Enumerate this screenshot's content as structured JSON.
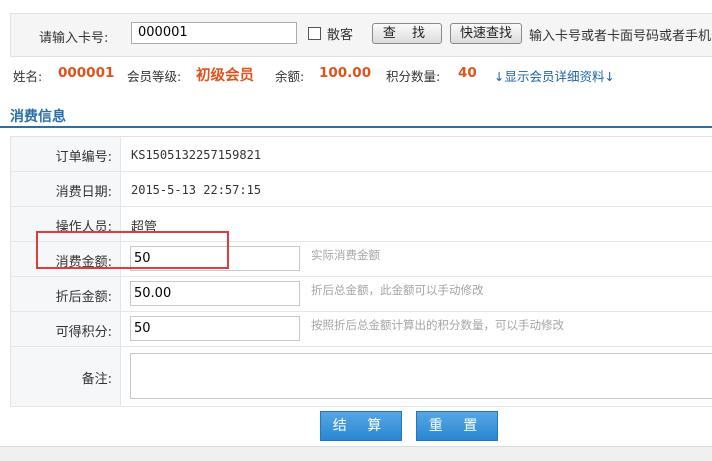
{
  "search": {
    "card_label": "请输入卡号:",
    "card_value": "000001",
    "walkin_label": "散客",
    "walkin_checked": false,
    "find_button": "查 找",
    "quick_find_button": "快速查找",
    "hint": "输入卡号或者卡面号码或者手机号"
  },
  "member": {
    "name_label": "姓名:",
    "name_value": "000001",
    "grade_label": "会员等级:",
    "grade_value": "初级会员",
    "balance_label": "余额:",
    "balance_value": "100.00",
    "points_label": "积分数量:",
    "points_value": "40",
    "details_link": "↓显示会员详细资料↓"
  },
  "section": {
    "title": "消费信息"
  },
  "form": {
    "order_no": {
      "label": "订单编号:",
      "value": "KS1505132257159821"
    },
    "date": {
      "label": "消费日期:",
      "value": "2015-5-13 22:57:15"
    },
    "operator": {
      "label": "操作人员:",
      "value": "超管"
    },
    "amount": {
      "label": "消费金额:",
      "value": "50",
      "hint": "实际消费金额"
    },
    "discounted": {
      "label": "折后金额:",
      "value": "50.00",
      "hint": "折后总金额，此金额可以手动修改"
    },
    "points": {
      "label": "可得积分:",
      "value": "50",
      "hint": "按照折后总金额计算出的积分数量，可以手动修改"
    },
    "notes": {
      "label": "备注:",
      "value": ""
    }
  },
  "actions": {
    "settle": "结 算",
    "reset": "重 置"
  },
  "colors": {
    "accent_blue": "#2a87d2",
    "highlight_red": "#e23b3b",
    "value_orange": "#e0531c"
  }
}
